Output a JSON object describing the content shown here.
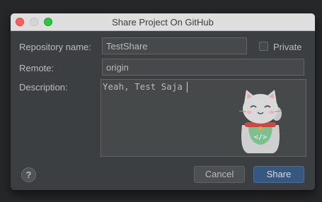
{
  "window": {
    "title": "Share Project On GitHub"
  },
  "form": {
    "repository_name_label": "Repository name:",
    "repository_name_value": "TestShare",
    "private_label": "Private",
    "private_checked": false,
    "remote_label": "Remote:",
    "remote_value": "origin",
    "description_label": "Description:",
    "description_value": "Yeah, Test Saja"
  },
  "buttons": {
    "help_label": "?",
    "cancel_label": "Cancel",
    "share_label": "Share"
  },
  "icons": {
    "close": "close-icon",
    "minimize": "minimize-icon",
    "maximize": "maximize-icon",
    "illustration": "lucky-cat-icon",
    "help": "help-icon"
  },
  "colors": {
    "dialog_background": "#3c3f41",
    "field_background": "#45494a",
    "primary_button": "#365880",
    "close": "#fc5f57",
    "maximize": "#29c840"
  }
}
